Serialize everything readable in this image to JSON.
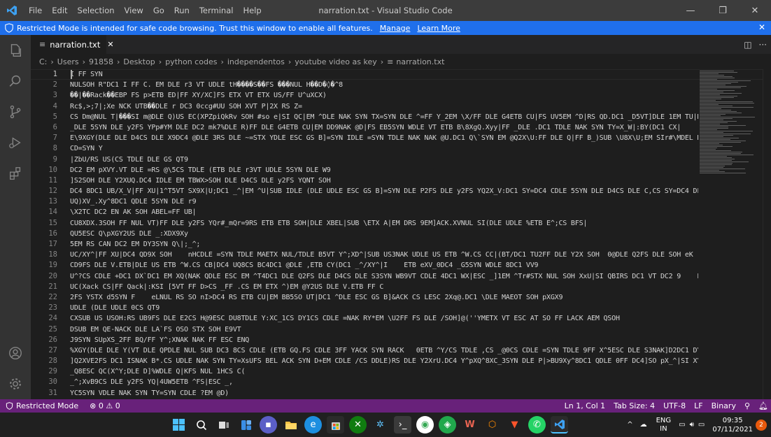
{
  "titlebar": {
    "menu": [
      "File",
      "Edit",
      "Selection",
      "View",
      "Go",
      "Run",
      "Terminal",
      "Help"
    ],
    "title": "narration.txt - Visual Studio Code"
  },
  "banner": {
    "message": "Restricted Mode is intended for safe code browsing. Trust this window to enable all features.",
    "manage": "Manage",
    "learn_more": "Learn More"
  },
  "tab": {
    "label": "narration.txt"
  },
  "breadcrumb": [
    "C:",
    "Users",
    "91858",
    "Desktop",
    "python codes",
    "independentos",
    "youtube video as key",
    "narration.txt"
  ],
  "editor": {
    "line_numbers": [
      "1",
      "2",
      "3",
      "4",
      "5",
      "6",
      "7",
      "8",
      "9",
      "10",
      "11",
      "12",
      "13",
      "14",
      "15",
      "16",
      "17",
      "18",
      "19",
      "20",
      "21",
      "22",
      "23",
      "24",
      "25",
      "26",
      "27",
      "28",
      "29",
      "30",
      "31"
    ],
    "lines": [
      "I FF SYN",
      "NULSOH R\"DC1 I FF C. EM DLE r3 VT UDLE tH����S��FS ���NUL H��D�◊�^8",
      "��|��Rack��EBP FS p>ETB ED|FF XY/XC]FS ETX VT ETX US/FF U^uXCX)",
      "Rc$,>;7|;Xe NCK UTB��DLE r DC3 0ccg#UU SOH XVT P|2X RS Z=",
      "CS Dm@NUL T|���SI m@DLE Q)US EC(XPZpiQkRv SOH #so e|SI QC|EM ^DLE NAK SYN TX=SYN DLE ^=FF Y_2EM \\X/FF DLE G4ETB CU|FS UV5EM ^D|RS QD.DC1 _D5VT]DLE 1EM TU|DLE Y]|EM DLE X9",
      "_DLE 5SYN DLE y2FS YPp#YM DLE DC2 mk7%DLE R)FF DLE G4ETB CU|EM DD9NAK @D|FS EB5SYN WDLE VT ETB B\\8XgQ.Xyy|FF _DLE .DC1 TDLE NAK SYN TY=X_W|:BY(DC1 CX|",
      "E\\9XGY(DLE DLE D4CS DLE X9DC4 @DLE 3RS DLE ~=STX YDLE ESC GS B]=SYN IDLE =SYN TDLE NAK NAK @U.DC1 Q\\`SYN EM @Q2X\\U:FF DLE Q|FF B_)SUB \\U8X\\U;EM SIr#\\MDEL NAK mk2%DLE d4CS DLE X3SYN _B5RS YS|6UD=DC2 YDLE t0Y^8",
      "CD=SYN Y",
      "|ZbU/RS US(CS TDLE DLE GS QT9",
      "DC2 EM pXVY.VT DLE =RS @\\5CS TDLE (ETB DLE r3VT UDLE 5SYN DLE W9",
      "]S2SOH DLE Y2XUQ.DC4 IDLE EM TBWX>SOH DLE D4CS DLE y2FS YQNT SOH",
      "DC4 8DC1 UB/X_V|FF XU|1^T5VT SX9X|U;DC1 _^|EM ^U|SUB IDLE (DLE UDLE ESC GS B]=SYN DLE P2FS DLE y2FS YQ2X_V:DC1 SY=DC4 CDLE 5SYN DLE D4CS DLE C,CS SY=DC4 DLE r)",
      "UQ)XV_.Xy^8DC1 QDLE 5SYN DLE r9",
      "\\X2TC DC2 EN AK SOH ABEL=FF UB|",
      "CU8XDX.3SOH FF NUL VT)FF DLE y2FS YQr#_mQr=9RS ETB ETB SOH|DLE XBEL|SUB \\ETX A|EM DRS 9EM]ACK.XVNUL SI(DLE UDLE %ETB E^;CS BFS|",
      "QU5ESC Q\\pXGY2US DLE _:XDX9Xy",
      "5EM RS CAN DC2 EM DY3SYN Q\\|;_^;",
      "UC/XY^|FF XU|DC4 QD9X SOH    nHCDLE =SYN TDLE MAETX NUL/TDLE B5VT Y^;XD^|SUB US3NAK UDLE US ETB ^W.CS CC|(BT/DC1 TU2FF DLE Y2X SOH  0@DLE Q2FS DLE SOH eK   RS BEL RS MDLE DC4 ETB GU*CS BFS|DLE UDLE +EM CDLE 3",
      "CD9FS DLE V.ETB|DLE US ETB ^W.CS CB|DC4 UQ8CS BC4DC1 @DLE ,ETB CY(DC1 _^/XY^|I    ETB eXV_0DC4 _G5SYN WDLE 8DC1 VV9",
      "U^?CS CDLE +DC1 DX`DC1 EM XQ(NAK QDLE ESC EM ^T4DC1 DLE Q2FS DLE D4CS DLE S3SYN WB9VT CDLE 4DC1 WX|ESC _]1EM ^Tr#STX NUL SOH XxU|SI QBIRS DC1 VT DC2 9    EU2FF \\I|RS \\QC RS NUL HDC1 2FS UB|DLE _E/CS DLE Q.",
      "UC(Xack CS|FF Qack|:KSI [5VT FF D>CS _FF .CS EM ETX ^)EM @Y2US DLE V.ETB FF C",
      "2FS YSTX d5SYN F    eLNUL RS SO nI>DC4 RS ETB CU|EM BB5SO UT|DC1 ^DLE ESC GS B]&ACK CS LESC 2Xq@.DC1 \\DLE MAEOT SOH pXGX9",
      "UDLE (DLE UDLE 0CS QT9",
      "CXSUB US USOH:RS UB9FS DLE E2CS H@9ESC DU8TDLE Y:XC_1CS DY1CS CDLE =NAK RY*EM \\U2FF FS DLE /SOH]@(''YMETX VT ESC AT SO FF LACK AEM QSOH",
      "DSUB EM QE-NACK DLE LA`FS OSO STX SOH E9VT",
      "J9SYN SUpXS_2FF BQ/FF Y^;XNAK NAK FF ESC ENQ",
      "%XGY(DLE DLE Y(VT DLE QPDLE NUL SUB DC3 8CS CDLE (ETB GQ.FS CDLE 3FF YACK SYN RACK   0ETB ^Y/CS TDLE ,CS _@0CS CDLE =SYN TDLE 9FF X^5ESC DLE S3NAK]D2DC1 DY9VT RS knJmknKmC<FS Ln3SO U]>CS BDLE MAEOT SOH pXGX(DLE DLE W",
      "]Q2XVE2FS DC1 ISNAK B*.CS UDLE NAK SYN TY=XsUFS BEL ACK SYN D+EM CDLE /CS DDLE)RS DLE Y2XrU.DC4 Y^pXQ^8XC_3SYN DLE P|>BU9Xy^8DC1 QDLE 0FF DC4]SO pX_^|SI XY?DLE DLE r3VT UDLE >",
      "_Q8ESC QC(X^Y;DLE D]%WDLE Q|KFS NUL 1HCS C(",
      "_^;XvB9CS DLE y2FS YQ|4UW5ETB ^FS|ESC _,",
      "YC5SYN VDLE NAK SYN TY=SYN CDLE ?EM @D)"
    ]
  },
  "statusbar": {
    "restricted": "Restricted Mode",
    "problems": "⊗ 0 ⚠ 0",
    "position": "Ln 1, Col 1",
    "tab_size": "Tab Size: 4",
    "encoding": "UTF-8",
    "eol": "LF",
    "language": "Binary"
  },
  "taskbar": {
    "lang_top": "ENG",
    "lang_bottom": "IN",
    "time": "09:35",
    "date": "07/11/2021",
    "notifications": "2"
  },
  "colors": {
    "statusbar": "#68217a",
    "banner": "#1f6feb",
    "titlebar": "#3c3c3c",
    "activitybar": "#333333",
    "editor": "#1e1e1e"
  }
}
